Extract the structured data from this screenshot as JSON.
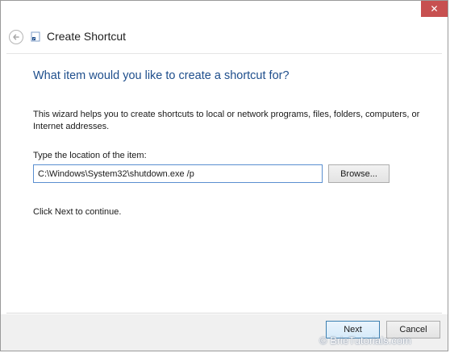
{
  "window": {
    "title": "Create Shortcut",
    "close_glyph": "✕",
    "accent_close": "#c75050"
  },
  "wizard": {
    "heading": "What item would you like to create a shortcut for?",
    "description": "This wizard helps you to create shortcuts to local or network programs, files, folders, computers, or Internet addresses.",
    "field_label": "Type the location of the item:",
    "location_value": "C:\\Windows\\System32\\shutdown.exe /p",
    "browse_label": "Browse...",
    "continue_text": "Click Next to continue.",
    "heading_color": "#1e4e8c"
  },
  "footer": {
    "next_label": "Next",
    "cancel_label": "Cancel"
  },
  "watermark": {
    "text": "© BrieTutorials.com"
  },
  "icons": {
    "back": "back-arrow-icon",
    "app": "shortcut-icon"
  }
}
